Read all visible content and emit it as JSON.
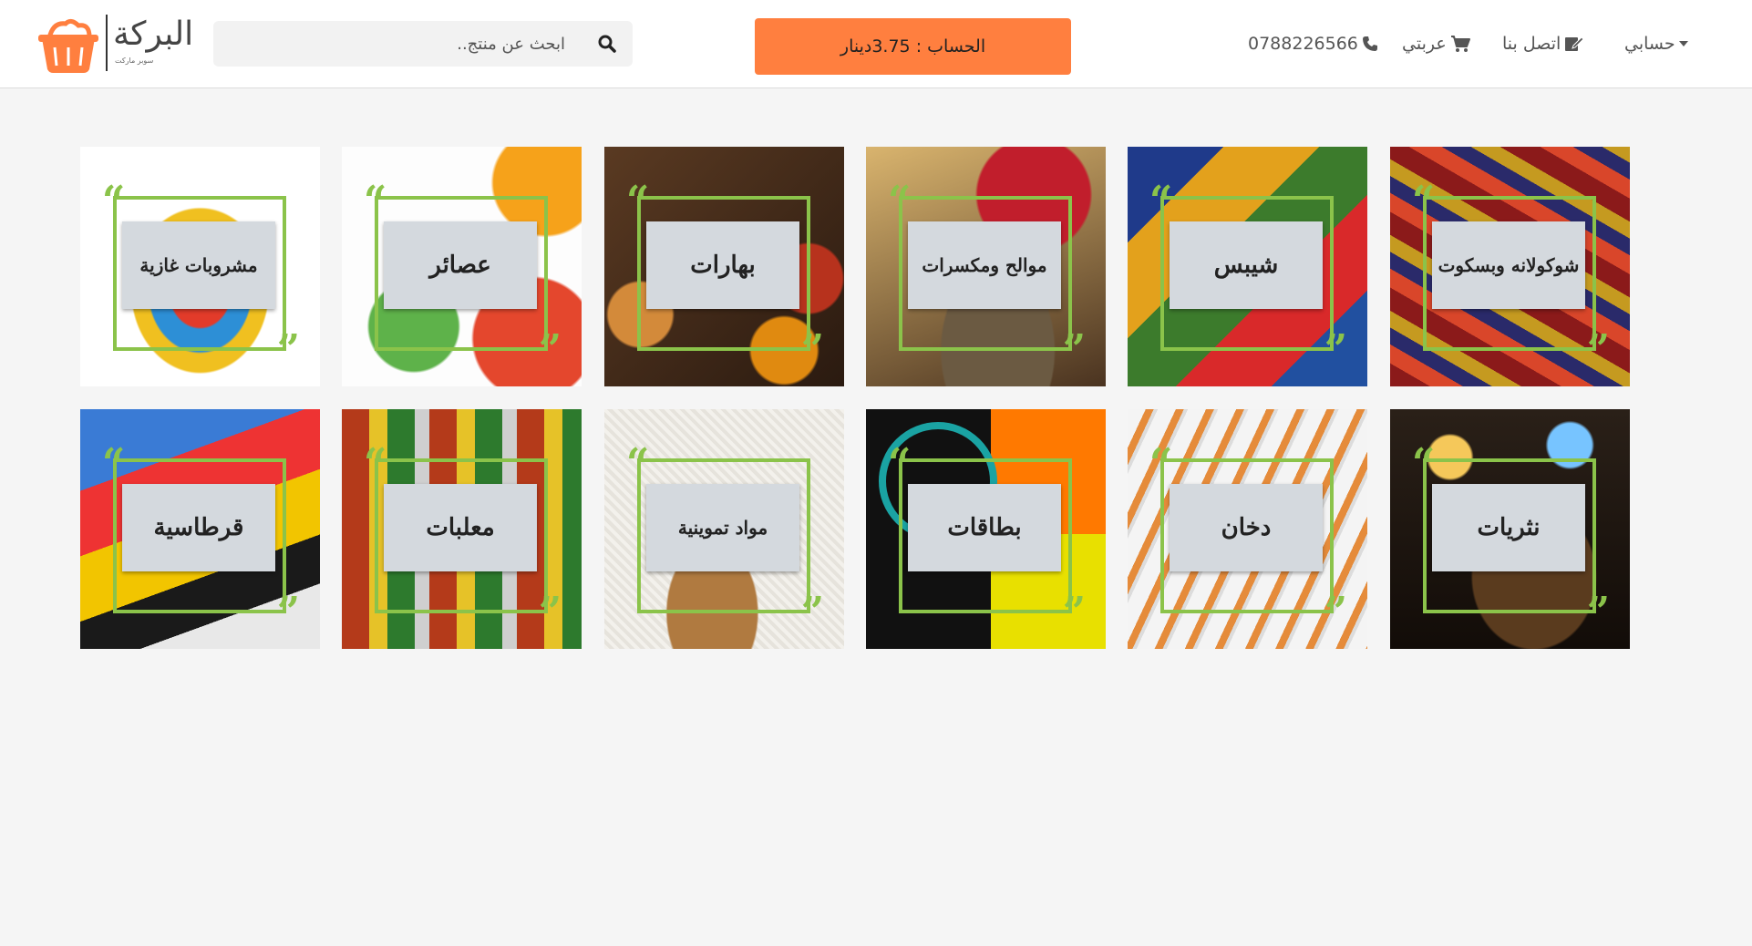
{
  "brand": {
    "name": "البركة",
    "subtitle": "سوبر ماركت",
    "accent_color": "#ff7f3f",
    "frame_color": "#8bc34a"
  },
  "search": {
    "placeholder": "ابحث عن منتج.."
  },
  "balance": {
    "label": "الحساب : 3.75دينار"
  },
  "nav": {
    "phone": "0788226566",
    "cart": "عربتي",
    "contact": "اتصل بنا",
    "account": "حسابي"
  },
  "categories": [
    {
      "label": "شوكولانه وبسكوت",
      "icon": "chocolate-biscuits"
    },
    {
      "label": "شيبس",
      "icon": "chips"
    },
    {
      "label": "موالح ومكسرات",
      "icon": "nuts"
    },
    {
      "label": "بهارات",
      "icon": "spices"
    },
    {
      "label": "عصائر",
      "icon": "juices"
    },
    {
      "label": "مشروبات غازية",
      "icon": "soft-drinks"
    },
    {
      "label": "نثريات",
      "icon": "miscellaneous"
    },
    {
      "label": "دخان",
      "icon": "cigarettes"
    },
    {
      "label": "بطاقات",
      "icon": "cards"
    },
    {
      "label": "مواد تموينية",
      "icon": "groceries"
    },
    {
      "label": "معلبات",
      "icon": "canned-food"
    },
    {
      "label": "قرطاسية",
      "icon": "stationery"
    }
  ]
}
